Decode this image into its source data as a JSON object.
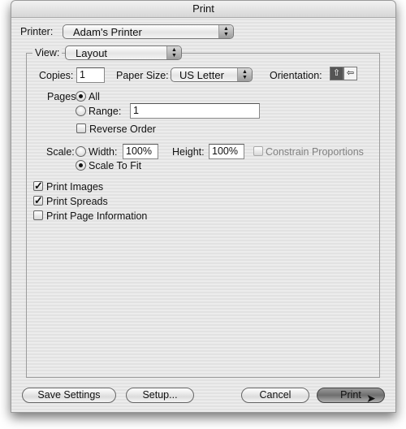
{
  "window": {
    "title": "Print"
  },
  "printer": {
    "label": "Printer:",
    "value": "Adam's Printer"
  },
  "view": {
    "label": "View:",
    "value": "Layout"
  },
  "copies": {
    "label": "Copies:",
    "value": "1"
  },
  "paper_size": {
    "label": "Paper Size:",
    "value": "US Letter"
  },
  "orientation": {
    "label": "Orientation:",
    "options": [
      {
        "name": "portrait",
        "icon": "portrait-icon",
        "selected": true
      },
      {
        "name": "landscape",
        "icon": "landscape-icon",
        "selected": false
      }
    ]
  },
  "pages": {
    "label": "Pages",
    "all_label": "All",
    "all_selected": true,
    "range_label": "Range:",
    "range_value": "1",
    "reverse_label": "Reverse Order",
    "reverse_checked": false
  },
  "scale": {
    "label": "Scale:",
    "width_label": "Width:",
    "width_value": "100%",
    "height_label": "Height:",
    "height_value": "100%",
    "constrain_label": "Constrain Proportions",
    "constrain_enabled": false,
    "fit_label": "Scale To Fit",
    "fit_selected": true
  },
  "options": [
    {
      "label": "Print Images",
      "checked": true
    },
    {
      "label": "Print Spreads",
      "checked": true
    },
    {
      "label": "Print Page Information",
      "checked": false
    }
  ],
  "buttons": {
    "save": "Save Settings",
    "setup": "Setup...",
    "cancel": "Cancel",
    "print": "Print"
  }
}
